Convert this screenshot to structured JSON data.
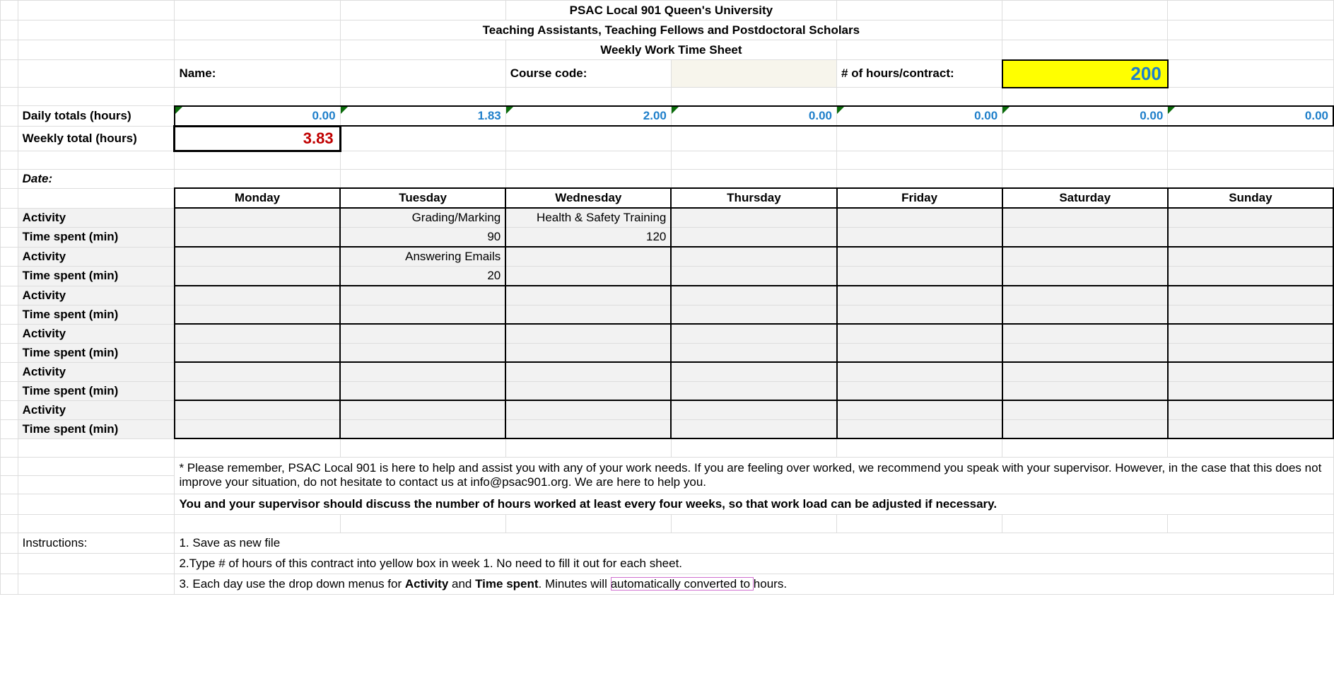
{
  "header": {
    "line1": "PSAC Local 901 Queen's University",
    "line2": "Teaching Assistants, Teaching Fellows and Postdoctoral Scholars",
    "line3": "Weekly Work Time Sheet"
  },
  "labels": {
    "name": "Name:",
    "course_code": "Course code:",
    "hours_contract": "# of hours/contract:",
    "daily_totals": "Daily totals (hours)",
    "weekly_total": "Weekly total (hours)",
    "date": "Date:",
    "activity": "Activity",
    "time_spent": "Time spent (min)",
    "instructions": "Instructions:"
  },
  "values": {
    "contract_hours": "200",
    "weekly_total": "3.83",
    "daily": [
      "0.00",
      "1.83",
      "2.00",
      "0.00",
      "0.00",
      "0.00",
      "0.00"
    ]
  },
  "days": [
    "Monday",
    "Tuesday",
    "Wednesday",
    "Thursday",
    "Friday",
    "Saturday",
    "Sunday"
  ],
  "activity_rows": [
    {
      "activity": [
        "",
        "Grading/Marking",
        "Health & Safety Training",
        "",
        "",
        "",
        ""
      ],
      "time": [
        "",
        "90",
        "120",
        "",
        "",
        "",
        ""
      ]
    },
    {
      "activity": [
        "",
        "Answering Emails",
        "",
        "",
        "",
        "",
        ""
      ],
      "time": [
        "",
        "20",
        "",
        "",
        "",
        "",
        ""
      ]
    },
    {
      "activity": [
        "",
        "",
        "",
        "",
        "",
        "",
        ""
      ],
      "time": [
        "",
        "",
        "",
        "",
        "",
        "",
        ""
      ]
    },
    {
      "activity": [
        "",
        "",
        "",
        "",
        "",
        "",
        ""
      ],
      "time": [
        "",
        "",
        "",
        "",
        "",
        "",
        ""
      ]
    },
    {
      "activity": [
        "",
        "",
        "",
        "",
        "",
        "",
        ""
      ],
      "time": [
        "",
        "",
        "",
        "",
        "",
        "",
        ""
      ]
    },
    {
      "activity": [
        "",
        "",
        "",
        "",
        "",
        "",
        ""
      ],
      "time": [
        "",
        "",
        "",
        "",
        "",
        "",
        ""
      ]
    }
  ],
  "notes": {
    "note1a": "* Please remember, PSAC Local 901 is here to help and assist you with any of your work needs. If you are feeling over worked, we recommend you speak with your supervisor. However, in the case that this does not improve your situation, do not hesitate to contact us at info@psac901.org. We are here to help you.",
    "note2_prefix": "You and your supervisor should discuss the number of hours worked at least every four weeks, so that work load can be adjusted if necessary.",
    "instr1": "1. Save as new file",
    "instr2": "2.Type # of hours of this contract into yellow box in week 1. No need to fill it out for each sheet.",
    "instr3_a": "3. Each day use the drop down menus for ",
    "instr3_b": "Activity",
    "instr3_c": " and ",
    "instr3_d": "Time spent",
    "instr3_e": ". Minutes will ",
    "instr3_f": "automatically converted to ",
    "instr3_g": "hours."
  }
}
